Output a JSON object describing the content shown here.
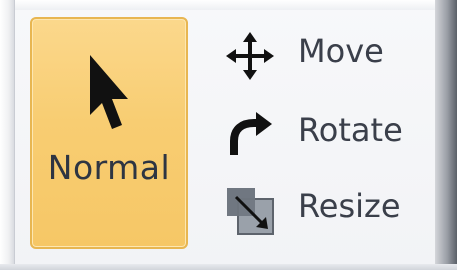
{
  "toolbar": {
    "normal_label": "Normal",
    "move_label": "Move",
    "rotate_label": "Rotate",
    "resize_label": "Resize"
  },
  "icons": {
    "normal": "pointer-arrow-icon",
    "move": "move-arrows-icon",
    "rotate": "rotate-arrow-icon",
    "resize": "resize-icon"
  },
  "colors": {
    "selected_fill": "#f8cd72",
    "selected_border": "#e8b651",
    "text": "#3a3f4a"
  }
}
